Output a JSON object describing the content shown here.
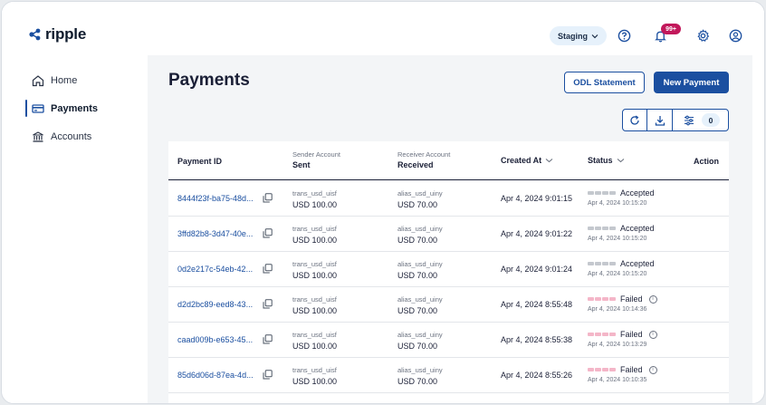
{
  "brand": {
    "name": "ripple"
  },
  "header": {
    "environment": "Staging",
    "notifications_badge": "99+"
  },
  "sidebar": {
    "items": [
      {
        "label": "Home",
        "icon": "home-icon",
        "active": false
      },
      {
        "label": "Payments",
        "icon": "payments-icon",
        "active": true
      },
      {
        "label": "Accounts",
        "icon": "bank-icon",
        "active": false
      }
    ]
  },
  "main": {
    "title": "Payments",
    "odl_statement_label": "ODL Statement",
    "new_payment_label": "New Payment",
    "filter_count": "0"
  },
  "table": {
    "columns": {
      "payment_id": "Payment ID",
      "sender_sub": "Sender Account",
      "sender": "Sent",
      "receiver_sub": "Receiver Account",
      "receiver": "Received",
      "created_at": "Created At",
      "status": "Status",
      "action": "Action"
    },
    "rows": [
      {
        "id": "8444f23f-ba75-48d...",
        "sender_account": "trans_usd_uisf",
        "sent": "USD  100.00",
        "receiver_account": "alias_usd_uiny",
        "received": "USD  70.00",
        "created_at": "Apr 4, 2024 9:01:15",
        "status": "Accepted",
        "status_date": "Apr 4, 2024 10:15:20",
        "failed": false
      },
      {
        "id": "3ffd82b8-3d47-40e...",
        "sender_account": "trans_usd_uisf",
        "sent": "USD  100.00",
        "receiver_account": "alias_usd_uiny",
        "received": "USD  70.00",
        "created_at": "Apr 4, 2024 9:01:22",
        "status": "Accepted",
        "status_date": "Apr 4, 2024 10:15:20",
        "failed": false
      },
      {
        "id": "0d2e217c-54eb-42...",
        "sender_account": "trans_usd_uisf",
        "sent": "USD  100.00",
        "receiver_account": "alias_usd_uiny",
        "received": "USD  70.00",
        "created_at": "Apr 4, 2024 9:01:24",
        "status": "Accepted",
        "status_date": "Apr 4, 2024 10:15:20",
        "failed": false
      },
      {
        "id": "d2d2bc89-eed8-43...",
        "sender_account": "trans_usd_uisf",
        "sent": "USD  100.00",
        "receiver_account": "alias_usd_uiny",
        "received": "USD  70.00",
        "created_at": "Apr 4, 2024 8:55:48",
        "status": "Failed",
        "status_date": "Apr 4, 2024 10:14:36",
        "failed": true
      },
      {
        "id": "caad009b-e653-45...",
        "sender_account": "trans_usd_uisf",
        "sent": "USD  100.00",
        "receiver_account": "alias_usd_uiny",
        "received": "USD  70.00",
        "created_at": "Apr 4, 2024 8:55:38",
        "status": "Failed",
        "status_date": "Apr 4, 2024 10:13:29",
        "failed": true
      },
      {
        "id": "85d6d06d-87ea-4d...",
        "sender_account": "trans_usd_uisf",
        "sent": "USD  100.00",
        "receiver_account": "alias_usd_uiny",
        "received": "USD  70.00",
        "created_at": "Apr 4, 2024 8:55:26",
        "status": "Failed",
        "status_date": "Apr 4, 2024 10:10:35",
        "failed": true
      }
    ]
  },
  "colors": {
    "accent": "#1b4fa0",
    "badge": "#c2185b",
    "failed_bars": "#f4b6c8",
    "accepted_bars": "#c4c8ce"
  }
}
